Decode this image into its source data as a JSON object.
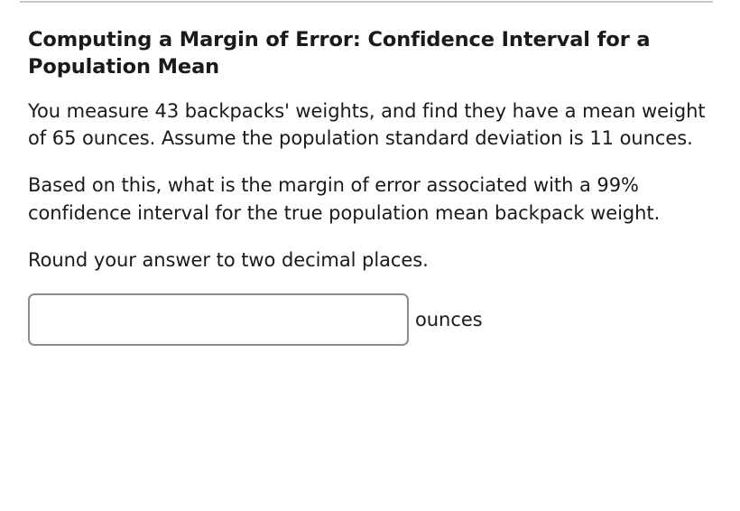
{
  "page": {
    "background_color": "#ffffff",
    "text_color": "#1a1a1a",
    "divider_color": "#c9c9c9",
    "input_border_color": "#8c8c8c"
  },
  "question": {
    "title": "Computing a Margin of Error: Confidence Interval for a Population Mean",
    "paragraphs": [
      "You measure 43 backpacks' weights, and find they have a mean weight of 65 ounces. Assume the population standard deviation is 11 ounces.",
      "Based on this, what is the margin of error associated with a 99% confidence interval for the true population mean backpack weight.",
      "Round your answer to two decimal places."
    ],
    "given": {
      "sample_size": "43",
      "sample_mean": "65",
      "population_standard_deviation": "11",
      "confidence_level": "99%",
      "units": "ounces",
      "rounding": "two decimal places"
    }
  },
  "answer": {
    "value": "",
    "placeholder": "",
    "unit_label": "ounces"
  }
}
